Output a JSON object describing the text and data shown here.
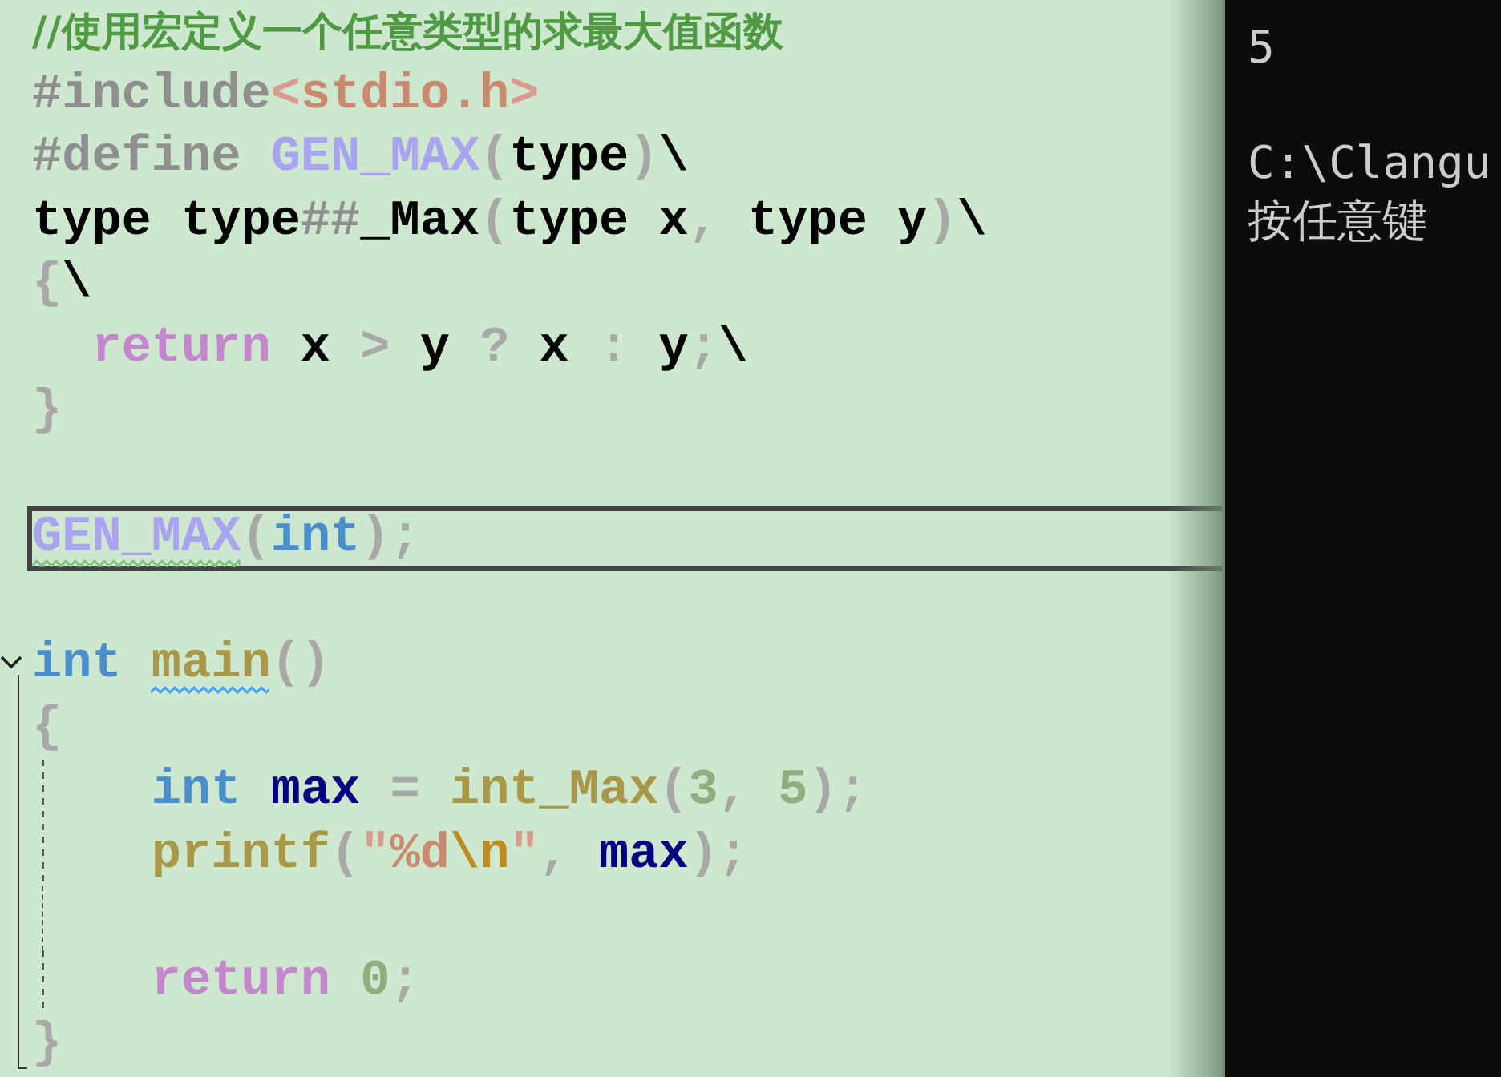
{
  "editor": {
    "lines": [
      {
        "kind": "plain",
        "current": false,
        "guide": false,
        "tokens": [
          {
            "text": "//使用宏定义一个任意类型的求最大值函数",
            "kind": "comment"
          }
        ]
      },
      {
        "kind": "plain",
        "current": false,
        "guide": false,
        "tokens": [
          {
            "text": "#include",
            "kind": "preproc"
          },
          {
            "text": "<",
            "kind": "include-bracket"
          },
          {
            "text": "stdio.h",
            "kind": "include-path"
          },
          {
            "text": ">",
            "kind": "include-bracket"
          }
        ]
      },
      {
        "kind": "plain",
        "current": false,
        "guide": false,
        "tokens": [
          {
            "text": "#define ",
            "kind": "preproc"
          },
          {
            "text": "GEN_MAX",
            "kind": "macro"
          },
          {
            "text": "(",
            "kind": "punct"
          },
          {
            "text": "type",
            "kind": "plain"
          },
          {
            "text": ")",
            "kind": "punct"
          },
          {
            "text": "\\",
            "kind": "plain"
          }
        ]
      },
      {
        "kind": "plain",
        "current": false,
        "guide": false,
        "tokens": [
          {
            "text": "type type",
            "kind": "plain"
          },
          {
            "text": "##",
            "kind": "preproc"
          },
          {
            "text": "_Max",
            "kind": "plain"
          },
          {
            "text": "(",
            "kind": "punct"
          },
          {
            "text": "type x",
            "kind": "plain"
          },
          {
            "text": ",",
            "kind": "punct"
          },
          {
            "text": " type y",
            "kind": "plain"
          },
          {
            "text": ")",
            "kind": "punct"
          },
          {
            "text": "\\",
            "kind": "plain"
          }
        ]
      },
      {
        "kind": "plain",
        "current": false,
        "guide": false,
        "tokens": [
          {
            "text": "{",
            "kind": "punct"
          },
          {
            "text": "\\",
            "kind": "plain"
          }
        ]
      },
      {
        "kind": "plain",
        "current": false,
        "guide": false,
        "tokens": [
          {
            "text": "  return",
            "kind": "control"
          },
          {
            "text": " x ",
            "kind": "plain"
          },
          {
            "text": ">",
            "kind": "punct"
          },
          {
            "text": " y ",
            "kind": "plain"
          },
          {
            "text": "?",
            "kind": "punct"
          },
          {
            "text": " x ",
            "kind": "plain"
          },
          {
            "text": ":",
            "kind": "punct"
          },
          {
            "text": " y",
            "kind": "plain"
          },
          {
            "text": ";",
            "kind": "punct"
          },
          {
            "text": "\\",
            "kind": "plain"
          }
        ]
      },
      {
        "kind": "plain",
        "current": false,
        "guide": false,
        "tokens": [
          {
            "text": "}",
            "kind": "punct"
          }
        ]
      },
      {
        "kind": "plain",
        "current": false,
        "guide": false
      },
      {
        "kind": "plain",
        "current": true,
        "guide": false,
        "tokens": [
          {
            "text": "GEN_MAX",
            "kind": "macro",
            "squiggle": {
              "color": "#7fc67f"
            }
          },
          {
            "text": "(",
            "kind": "punct"
          },
          {
            "text": "int",
            "kind": "keyword"
          },
          {
            "text": ")",
            "kind": "punct"
          },
          {
            "text": ";",
            "kind": "punct"
          }
        ]
      },
      {
        "kind": "plain",
        "current": false,
        "guide": false
      },
      {
        "kind": "fold-start",
        "current": false,
        "guide": false,
        "tokens": [
          {
            "text": "int ",
            "kind": "keyword"
          },
          {
            "text": "main",
            "kind": "func",
            "squiggle": {
              "color": "#4aa3ff"
            }
          },
          {
            "text": "()",
            "kind": "punct"
          }
        ]
      },
      {
        "kind": "fold-body",
        "current": false,
        "guide": false,
        "tokens": [
          {
            "text": "{",
            "kind": "punct"
          }
        ]
      },
      {
        "kind": "fold-body",
        "current": false,
        "guide": true,
        "tokens": [
          {
            "text": "    int",
            "kind": "keyword"
          },
          {
            "text": " max ",
            "kind": "var"
          },
          {
            "text": "=",
            "kind": "punct"
          },
          {
            "text": " int_Max",
            "kind": "func"
          },
          {
            "text": "(",
            "kind": "punct"
          },
          {
            "text": "3",
            "kind": "number"
          },
          {
            "text": ",",
            "kind": "punct"
          },
          {
            "text": " 5",
            "kind": "number"
          },
          {
            "text": ");",
            "kind": "punct"
          }
        ]
      },
      {
        "kind": "fold-body",
        "current": false,
        "guide": true,
        "tokens": [
          {
            "text": "    printf",
            "kind": "func"
          },
          {
            "text": "(",
            "kind": "punct"
          },
          {
            "text": "\"",
            "kind": "string-quote"
          },
          {
            "text": "%d",
            "kind": "string"
          },
          {
            "text": "\\n",
            "kind": "escape"
          },
          {
            "text": "\"",
            "kind": "string-quote"
          },
          {
            "text": ",",
            "kind": "punct"
          },
          {
            "text": " max",
            "kind": "var"
          },
          {
            "text": ");",
            "kind": "punct"
          }
        ]
      },
      {
        "kind": "fold-body",
        "current": false,
        "guide": true
      },
      {
        "kind": "fold-body",
        "current": false,
        "guide": true,
        "tokens": [
          {
            "text": "    return",
            "kind": "control"
          },
          {
            "text": " 0",
            "kind": "number"
          },
          {
            "text": ";",
            "kind": "punct"
          }
        ]
      },
      {
        "kind": "fold-end",
        "current": false,
        "guide": false,
        "tokens": [
          {
            "text": "}",
            "kind": "punct"
          }
        ]
      }
    ]
  },
  "console": {
    "blocks": [
      {
        "lines": [
          "5"
        ]
      },
      {
        "lines": [
          "C:\\Clangu",
          "按任意键"
        ]
      }
    ]
  }
}
